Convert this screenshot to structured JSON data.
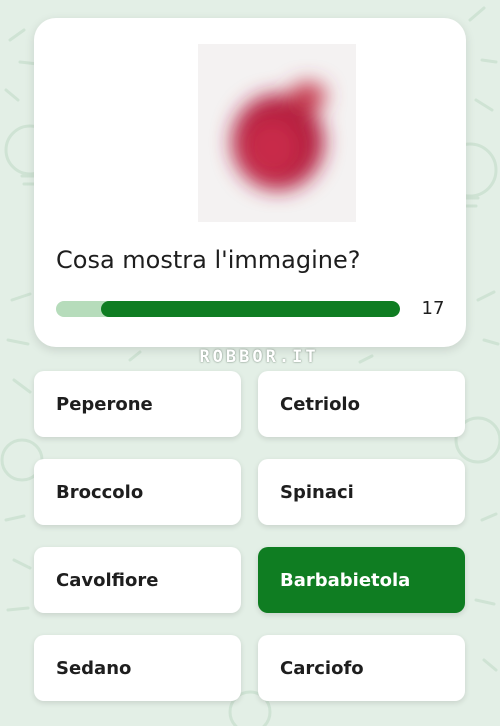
{
  "quiz": {
    "question": "Cosa mostra l'immagine?",
    "timer": "17",
    "progress_fraction": 0.87,
    "image_icon": "blurred-red-vegetable-image",
    "watermark": "ROBBOR.IT"
  },
  "answers": [
    {
      "label": "Peperone",
      "selected": false
    },
    {
      "label": "Cetriolo",
      "selected": false
    },
    {
      "label": "Broccolo",
      "selected": false
    },
    {
      "label": "Spinaci",
      "selected": false
    },
    {
      "label": "Cavolfiore",
      "selected": false
    },
    {
      "label": "Barbabietola",
      "selected": true
    },
    {
      "label": "Sedano",
      "selected": false
    },
    {
      "label": "Carciofo",
      "selected": false
    }
  ],
  "colors": {
    "background": "#e3efe6",
    "accent": "#0f7d22",
    "progress_track": "#b6dcbb"
  }
}
